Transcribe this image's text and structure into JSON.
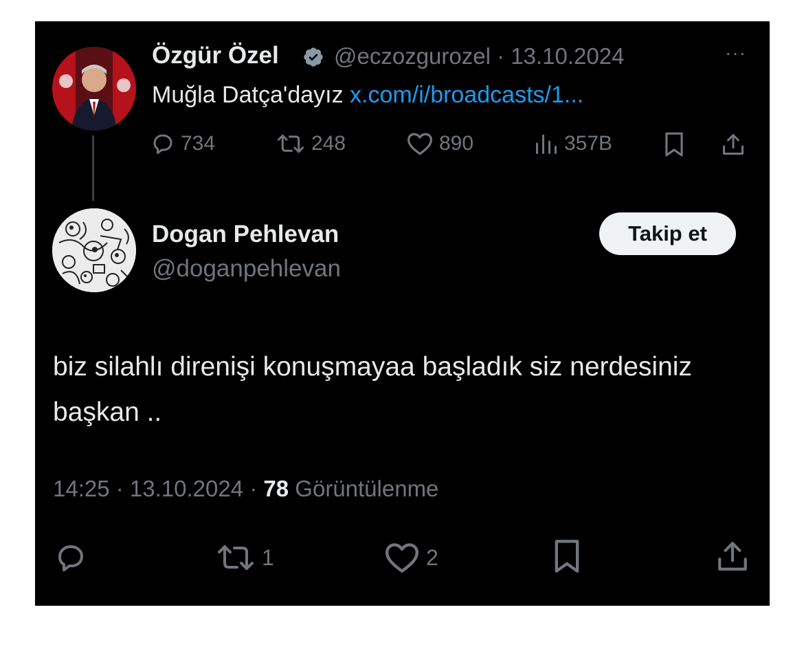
{
  "original_post": {
    "author_name": "Özgür Özel",
    "verified_icon": "verified-badge-icon",
    "handle_date": "@eczozgurozel · 13.10.2024",
    "more_label": "···",
    "text": "Muğla Datça'dayız ",
    "link": "x.com/i/broadcasts/1...",
    "actions": {
      "replies": "734",
      "reposts": "248",
      "likes": "890",
      "views": "357B"
    }
  },
  "reply": {
    "author_name": "Dogan Pehlevan",
    "handle": "@doganpehlevan",
    "follow_label": "Takip et",
    "text": "biz silahlı direnişi konuşmayaa başladık siz nerdesiniz başkan ..",
    "time_date": "14:25 · 13.10.2024 · ",
    "views_count": "78",
    "views_label": " Görüntülenme",
    "actions": {
      "reposts": "1",
      "likes": "2"
    }
  },
  "colors": {
    "background": "#000000",
    "text_primary": "#e7e9ea",
    "text_secondary": "#71767b",
    "link": "#1d9bf0",
    "verified_badge": "#8b98a5",
    "follow_button_bg": "#eff3f4"
  }
}
